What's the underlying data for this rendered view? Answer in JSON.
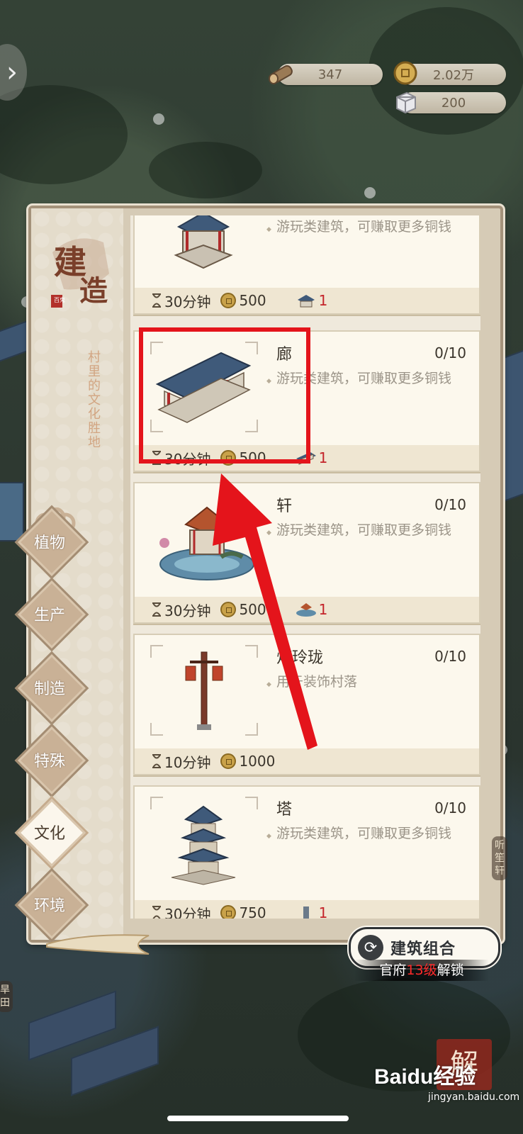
{
  "resources": {
    "wood": "347",
    "copper": "2.02万",
    "stone": "200"
  },
  "panel": {
    "title": "建造",
    "stamp": "百鬼",
    "subtitle": "村里的文化胜地"
  },
  "tabs": [
    {
      "label": "植物",
      "active": false
    },
    {
      "label": "生产",
      "active": false
    },
    {
      "label": "制造",
      "active": false
    },
    {
      "label": "特殊",
      "active": false
    },
    {
      "label": "文化",
      "active": true
    },
    {
      "label": "环境",
      "active": false
    }
  ],
  "buildings": [
    {
      "name": "",
      "count": "",
      "desc": "游玩类建筑，可赚取更多铜钱",
      "time": "30分钟",
      "cost": "500",
      "req": "1",
      "icon": "pavilion-icon"
    },
    {
      "name": "廊",
      "count": "0/10",
      "desc": "游玩类建筑，可赚取更多铜钱",
      "time": "30分钟",
      "cost": "500",
      "req": "1",
      "icon": "corridor-icon"
    },
    {
      "name": "轩",
      "count": "0/10",
      "desc": "游玩类建筑，可赚取更多铜钱",
      "time": "30分钟",
      "cost": "500",
      "req": "1",
      "icon": "gazebo-icon"
    },
    {
      "name": "灯玲珑",
      "count": "0/10",
      "desc": "用于装饰村落",
      "time": "10分钟",
      "cost": "1000",
      "req": "",
      "icon": "lamp-post-icon"
    },
    {
      "name": "塔",
      "count": "0/10",
      "desc": "游玩类建筑，可赚取更多铜钱",
      "time": "30分钟",
      "cost": "750",
      "req": "1",
      "icon": "pagoda-icon"
    }
  ],
  "combo_button": {
    "label": "建筑组合"
  },
  "unlock_hint": {
    "prefix": "官府",
    "level": "13级",
    "suffix": "解锁"
  },
  "side_labels": {
    "right": "听笙轩",
    "left": "旱田"
  },
  "watermark": {
    "brand": "Baidu经验",
    "url": "jingyan.baidu.com",
    "seal": "解"
  },
  "colors": {
    "highlight": "#e4141b",
    "accent": "#c4242a",
    "panel": "#d6cbb6"
  }
}
